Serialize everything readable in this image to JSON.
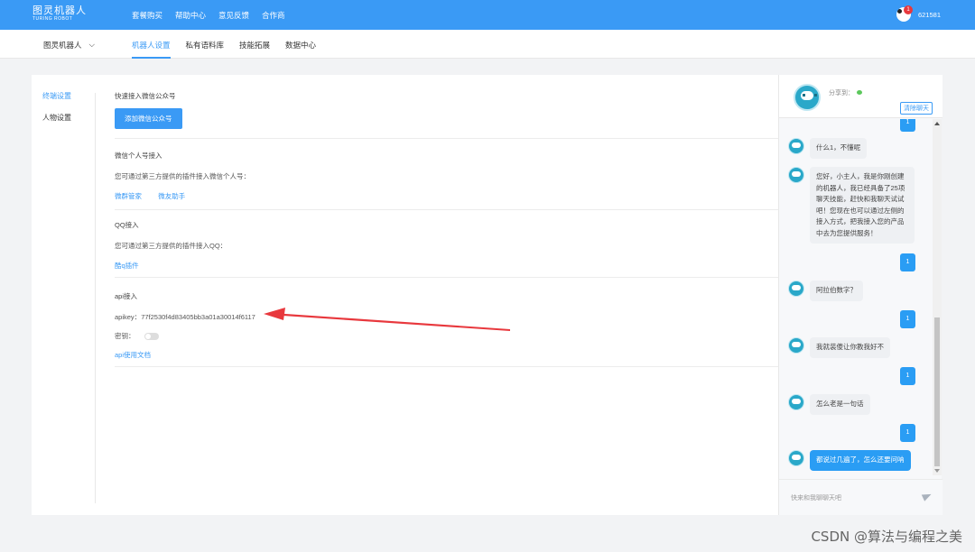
{
  "topbar": {
    "logo_cn": "图灵机器人",
    "logo_en": "TURING ROBOT",
    "nav": [
      "套餐购买",
      "帮助中心",
      "意见反馈",
      "合作商"
    ],
    "notification_count": "1",
    "user_id": "621581"
  },
  "subnav": {
    "robot_select": "图灵机器人",
    "tabs": [
      "机器人设置",
      "私有语料库",
      "技能拓展",
      "数据中心"
    ]
  },
  "left_menu": {
    "items": [
      "终端设置",
      "人物设置"
    ]
  },
  "sections": {
    "wechat_mp": {
      "title": "快速接入微信公众号",
      "button": "添加微信公众号"
    },
    "wechat_personal": {
      "title": "微信个人号接入",
      "desc": "您可通过第三方提供的插件接入微信个人号：",
      "links": [
        "微群管家",
        "微友助手"
      ]
    },
    "qq": {
      "title": "QQ接入",
      "desc": "您可通过第三方提供的插件接入QQ：",
      "link": "酷q插件"
    },
    "api": {
      "title": "api接入",
      "apikey_label": "apikey：",
      "apikey_value": "77f2530f4d83405bb3a01a30014f6117",
      "secret_label": "密钥：",
      "doc_link": "api使用文档"
    }
  },
  "annotation": {
    "arrow_color": "#e8383d"
  },
  "chat": {
    "share_label": "分享到：",
    "clear_button": "清除聊天",
    "messages": [
      {
        "from": "user",
        "text": "1"
      },
      {
        "from": "bot",
        "text": "什么1，不懂呢"
      },
      {
        "from": "bot",
        "text": "您好，小主人，我是你刚创建的机器人，我已经具备了25项聊天技能，赶快和我聊天试试吧！您现在也可以通过左侧的接入方式，把我接入您的产品中去为您提供服务！"
      },
      {
        "from": "user",
        "text": "1"
      },
      {
        "from": "bot",
        "text": "阿拉伯数字？"
      },
      {
        "from": "user",
        "text": "1"
      },
      {
        "from": "bot",
        "text": "我就装傻让你教我好不"
      },
      {
        "from": "user",
        "text": "1"
      },
      {
        "from": "bot",
        "text": "怎么老是一句话"
      },
      {
        "from": "user",
        "text": "1"
      },
      {
        "from": "bot",
        "text": "都说过几遍了，怎么还要问呐",
        "highlight": true
      }
    ],
    "input_placeholder": "快来和我聊聊天吧"
  },
  "watermark": "CSDN @算法与编程之美",
  "colors": {
    "primary": "#3a9af5",
    "arrow": "#e8383d"
  }
}
